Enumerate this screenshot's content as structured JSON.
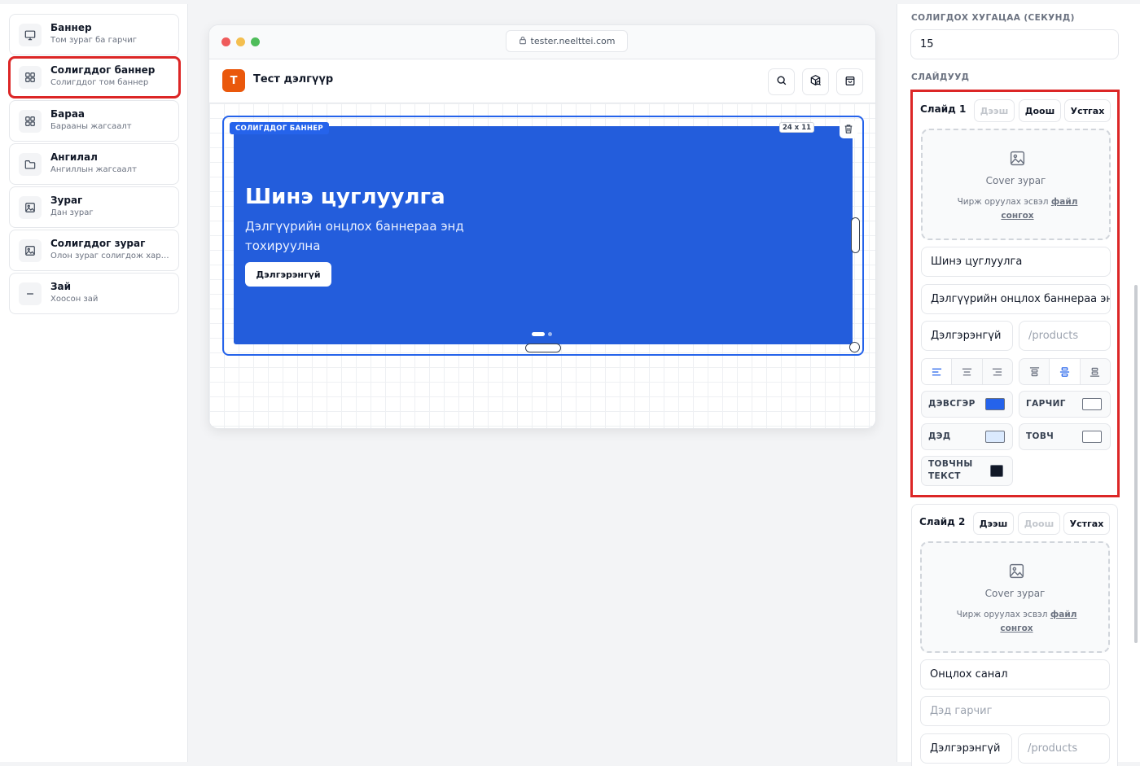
{
  "blocks": [
    {
      "title": "Баннер",
      "sub": "Том зураг ба гарчиг",
      "icon": "monitor-icon"
    },
    {
      "title": "Солигддог баннер",
      "sub": "Солигддог том баннер",
      "icon": "grid-icon"
    },
    {
      "title": "Бараа",
      "sub": "Барааны жагсаалт",
      "icon": "grid-icon"
    },
    {
      "title": "Ангилал",
      "sub": "Ангиллын жагсаалт",
      "icon": "folder-icon"
    },
    {
      "title": "Зураг",
      "sub": "Дан зураг",
      "icon": "image-icon"
    },
    {
      "title": "Солигддог зураг",
      "sub": "Олон зураг солигдож харагдана",
      "icon": "image-icon"
    },
    {
      "title": "Зай",
      "sub": "Хоосон зай",
      "icon": "minus-icon"
    }
  ],
  "preview": {
    "url": "tester.neelttei.com",
    "shop_initial": "T",
    "shop_name": "Тест дэлгүүр",
    "banner_tag": "СОЛИГДДОГ БАННЕР",
    "size_badge": "24 x 11",
    "slide_title": "Шинэ цуглуулга",
    "slide_subtitle": "Дэлгүүрийн онцлох баннераа энд тохируулна",
    "slide_button": "Дэлгэрэнгүй",
    "dot_count": 2,
    "active_dot": 0
  },
  "panel": {
    "interval_label": "СОЛИГДОХ ХУГАЦАА (СЕКУНД)",
    "interval_value": "15",
    "slides_label": "СЛАЙДУУД",
    "up_label": "Дээш",
    "down_label": "Доош",
    "remove_label": "Устгах",
    "cover_title": "Cover зураг",
    "upload_hint": "Чирж оруулах эсвэл",
    "upload_link": "файл сонгох",
    "slide1": {
      "name": "Слайд 1",
      "title_value": "Шинэ цуглуулга",
      "subtitle_value": "Дэлгүүрийн онцлох баннераа энд тохируулна",
      "button_value": "Дэлгэрэнгүй",
      "link_placeholder": "/products",
      "bg_label": "ДЭВСГЭР",
      "title_color_label": "ГАРЧИГ",
      "sub_color_label": "ДЭД",
      "btn_color_label": "ТОВЧ",
      "btn_text_color_label": "ТОВЧНЫ ТЕКСТ"
    },
    "slide2": {
      "name": "Слайд 2",
      "title_value": "Онцлох санал",
      "subtitle_placeholder": "Дэд гарчиг",
      "button_value": "Дэлгэрэнгүй",
      "link_placeholder": "/products"
    }
  },
  "colors": {
    "accent": "#2563eb",
    "banner_bg": "#235ddc",
    "selection": "#dc2626",
    "bg_swatch": "#2563eb",
    "title_swatch": "#ffffff",
    "sub_swatch": "#dbeafe",
    "btn_swatch": "#ffffff",
    "btn_text_swatch": "#111827"
  }
}
